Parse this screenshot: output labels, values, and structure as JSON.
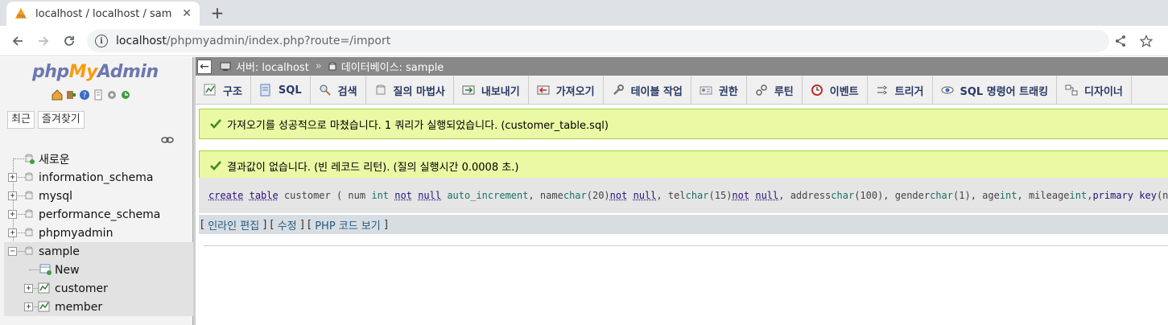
{
  "browser": {
    "tab_title": "localhost / localhost / sam",
    "new_tab_label": "+",
    "url_host": "localhost",
    "url_path": "/phpmyadmin/index.php?route=/import"
  },
  "pma": {
    "logo_php": "php",
    "logo_my": "My",
    "logo_admin": "Admin",
    "recent_label": "최근",
    "favorites_label": "즐겨찾기",
    "tree": {
      "new_label": "새로운",
      "databases": [
        "information_schema",
        "mysql",
        "performance_schema",
        "phpmyadmin",
        "sample"
      ],
      "sample_children": {
        "new_label": "New",
        "tables": [
          "customer",
          "member"
        ]
      }
    }
  },
  "main": {
    "breadcrumb": {
      "server": "서버: localhost",
      "database": "데이터베이스: sample"
    },
    "menu": [
      {
        "label": "구조",
        "icon": "structure-icon"
      },
      {
        "label": "SQL",
        "icon": "sql-icon"
      },
      {
        "label": "검색",
        "icon": "search-icon"
      },
      {
        "label": "질의 마법사",
        "icon": "query-wizard-icon"
      },
      {
        "label": "내보내기",
        "icon": "export-icon"
      },
      {
        "label": "가져오기",
        "icon": "import-icon"
      },
      {
        "label": "테이블 작업",
        "icon": "operations-icon"
      },
      {
        "label": "권한",
        "icon": "privileges-icon"
      },
      {
        "label": "루틴",
        "icon": "routines-icon"
      },
      {
        "label": "이벤트",
        "icon": "events-icon"
      },
      {
        "label": "트리거",
        "icon": "triggers-icon"
      },
      {
        "label": "SQL 명령어 트래킹",
        "icon": "tracking-icon"
      },
      {
        "label": "디자이너",
        "icon": "designer-icon"
      }
    ],
    "import_success": "가져오기를 성공적으로 마쳤습니다. 1 쿼리가 실행되었습니다. (customer_table.sql)",
    "result_message": "결과값이 없습니다. (빈 레코드 리턴). (질의 실행시간 0.0008 초.)",
    "sql_actions": {
      "open": "[",
      "inline_edit": "인라인 편집",
      "sep1": "] [",
      "edit": "수정",
      "sep2": "] [",
      "php_code": "PHP 코드 보기",
      "close": "]"
    }
  },
  "colors": {
    "success_bg": "#ebf8a4",
    "success_border": "#a2d246",
    "breadcrumb_bg": "#888888",
    "menu_text": "#2a3a66",
    "sql_keyword": "#2a0f7e",
    "sql_type": "#197163"
  }
}
